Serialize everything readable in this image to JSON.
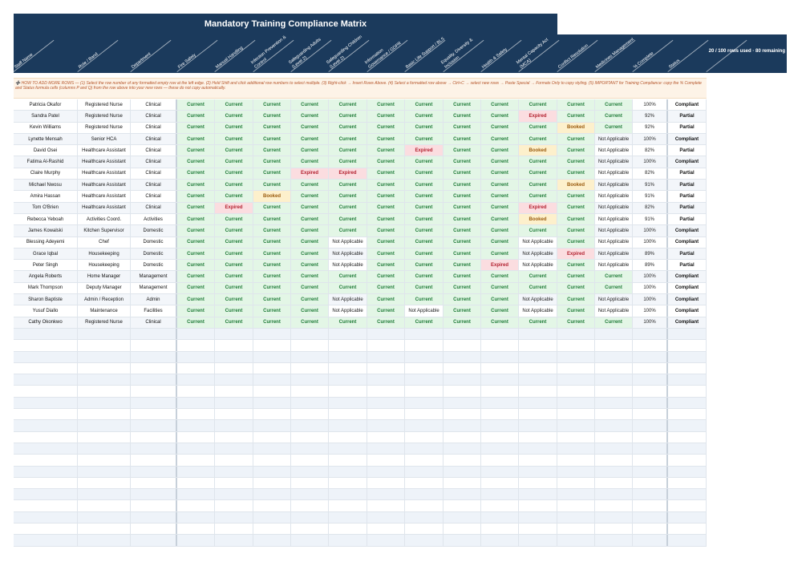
{
  "title": "Mandatory Training Compliance Matrix",
  "rows_used": "20 / 100 rows used  ·  80 remaining",
  "columns": [
    [
      "Staff Name"
    ],
    [
      "Role / Band"
    ],
    [
      "Department"
    ],
    [
      "Fire Safety"
    ],
    [
      "Manual Handling"
    ],
    [
      "Infection Prevention &",
      "Control"
    ],
    [
      "Safeguarding Adults",
      "(Level 2)"
    ],
    [
      "Safeguarding Children",
      "(Level 2)"
    ],
    [
      "Information",
      "Governance / GDPR"
    ],
    [
      "Basic Life Support / BLS"
    ],
    [
      "Equality, Diversity &",
      "Inclusion"
    ],
    [
      "Health & Safety"
    ],
    [
      "Mental Capacity Act",
      "(MCA)"
    ],
    [
      "Conflict Resolution"
    ],
    [
      "Medicines Management"
    ],
    [
      "% Complete"
    ],
    [
      "Status"
    ]
  ],
  "instructions": "➕ HOW TO ADD MORE ROWS  —  (1) Select the row number of any formatted empty row at the left edge.  (2) Hold Shift and click additional row numbers to select multiple.  (3) Right-click → Insert Rows Above.  (4) Select a formatted row above → Ctrl+C → select new rows → Paste Special → Formats Only to copy styling.  (5) IMPORTANT for Training Compliance: copy the % Complete and Status formula cells (columns P and Q) from the row above into your new rows — these do not copy automatically.",
  "rows": [
    {
      "name": "Patricia Okafor",
      "role": "Registered Nurse",
      "dept": "Clinical",
      "t": [
        "Current",
        "Current",
        "Current",
        "Current",
        "Current",
        "Current",
        "Current",
        "Current",
        "Current",
        "Current",
        "Current",
        "Current"
      ],
      "pct": "100%",
      "status": "Compliant"
    },
    {
      "name": "Sandra Patel",
      "role": "Registered Nurse",
      "dept": "Clinical",
      "t": [
        "Current",
        "Current",
        "Current",
        "Current",
        "Current",
        "Current",
        "Current",
        "Current",
        "Current",
        "Expired",
        "Current",
        "Current"
      ],
      "pct": "92%",
      "status": "Partial"
    },
    {
      "name": "Kevin Williams",
      "role": "Registered Nurse",
      "dept": "Clinical",
      "t": [
        "Current",
        "Current",
        "Current",
        "Current",
        "Current",
        "Current",
        "Current",
        "Current",
        "Current",
        "Current",
        "Booked",
        "Current"
      ],
      "pct": "92%",
      "status": "Partial"
    },
    {
      "name": "Lynette Mensah",
      "role": "Senior HCA",
      "dept": "Clinical",
      "t": [
        "Current",
        "Current",
        "Current",
        "Current",
        "Current",
        "Current",
        "Current",
        "Current",
        "Current",
        "Current",
        "Current",
        "Not Applicable"
      ],
      "pct": "100%",
      "status": "Compliant"
    },
    {
      "name": "David Osei",
      "role": "Healthcare Assistant",
      "dept": "Clinical",
      "t": [
        "Current",
        "Current",
        "Current",
        "Current",
        "Current",
        "Current",
        "Expired",
        "Current",
        "Current",
        "Booked",
        "Current",
        "Not Applicable"
      ],
      "pct": "82%",
      "status": "Partial"
    },
    {
      "name": "Fatima Al-Rashid",
      "role": "Healthcare Assistant",
      "dept": "Clinical",
      "t": [
        "Current",
        "Current",
        "Current",
        "Current",
        "Current",
        "Current",
        "Current",
        "Current",
        "Current",
        "Current",
        "Current",
        "Not Applicable"
      ],
      "pct": "100%",
      "status": "Compliant"
    },
    {
      "name": "Claire Murphy",
      "role": "Healthcare Assistant",
      "dept": "Clinical",
      "t": [
        "Current",
        "Current",
        "Current",
        "Expired",
        "Expired",
        "Current",
        "Current",
        "Current",
        "Current",
        "Current",
        "Current",
        "Not Applicable"
      ],
      "pct": "82%",
      "status": "Partial"
    },
    {
      "name": "Michael Nwosu",
      "role": "Healthcare Assistant",
      "dept": "Clinical",
      "t": [
        "Current",
        "Current",
        "Current",
        "Current",
        "Current",
        "Current",
        "Current",
        "Current",
        "Current",
        "Current",
        "Booked",
        "Not Applicable"
      ],
      "pct": "91%",
      "status": "Partial"
    },
    {
      "name": "Amira Hassan",
      "role": "Healthcare Assistant",
      "dept": "Clinical",
      "t": [
        "Current",
        "Current",
        "Booked",
        "Current",
        "Current",
        "Current",
        "Current",
        "Current",
        "Current",
        "Current",
        "Current",
        "Not Applicable"
      ],
      "pct": "91%",
      "status": "Partial"
    },
    {
      "name": "Tom O'Brien",
      "role": "Healthcare Assistant",
      "dept": "Clinical",
      "t": [
        "Current",
        "Expired",
        "Current",
        "Current",
        "Current",
        "Current",
        "Current",
        "Current",
        "Current",
        "Expired",
        "Current",
        "Not Applicable"
      ],
      "pct": "82%",
      "status": "Partial"
    },
    {
      "name": "Rebecca Yeboah",
      "role": "Activities Coord.",
      "dept": "Activities",
      "t": [
        "Current",
        "Current",
        "Current",
        "Current",
        "Current",
        "Current",
        "Current",
        "Current",
        "Current",
        "Booked",
        "Current",
        "Not Applicable"
      ],
      "pct": "91%",
      "status": "Partial"
    },
    {
      "name": "James Kowalski",
      "role": "Kitchen Supervisor",
      "dept": "Domestic",
      "t": [
        "Current",
        "Current",
        "Current",
        "Current",
        "Current",
        "Current",
        "Current",
        "Current",
        "Current",
        "Current",
        "Current",
        "Not Applicable"
      ],
      "pct": "100%",
      "status": "Compliant"
    },
    {
      "name": "Blessing Adeyemi",
      "role": "Chef",
      "dept": "Domestic",
      "t": [
        "Current",
        "Current",
        "Current",
        "Current",
        "Not Applicable",
        "Current",
        "Current",
        "Current",
        "Current",
        "Not Applicable",
        "Current",
        "Not Applicable"
      ],
      "pct": "100%",
      "status": "Compliant"
    },
    {
      "name": "Grace Iqbal",
      "role": "Housekeeping",
      "dept": "Domestic",
      "t": [
        "Current",
        "Current",
        "Current",
        "Current",
        "Not Applicable",
        "Current",
        "Current",
        "Current",
        "Current",
        "Not Applicable",
        "Expired",
        "Not Applicable"
      ],
      "pct": "89%",
      "status": "Partial"
    },
    {
      "name": "Peter Singh",
      "role": "Housekeeping",
      "dept": "Domestic",
      "t": [
        "Current",
        "Current",
        "Current",
        "Current",
        "Not Applicable",
        "Current",
        "Current",
        "Current",
        "Expired",
        "Not Applicable",
        "Current",
        "Not Applicable"
      ],
      "pct": "89%",
      "status": "Partial"
    },
    {
      "name": "Angela Roberts",
      "role": "Home Manager",
      "dept": "Management",
      "t": [
        "Current",
        "Current",
        "Current",
        "Current",
        "Current",
        "Current",
        "Current",
        "Current",
        "Current",
        "Current",
        "Current",
        "Current"
      ],
      "pct": "100%",
      "status": "Compliant"
    },
    {
      "name": "Mark Thompson",
      "role": "Deputy Manager",
      "dept": "Management",
      "t": [
        "Current",
        "Current",
        "Current",
        "Current",
        "Current",
        "Current",
        "Current",
        "Current",
        "Current",
        "Current",
        "Current",
        "Current"
      ],
      "pct": "100%",
      "status": "Compliant"
    },
    {
      "name": "Sharon Baptiste",
      "role": "Admin / Reception",
      "dept": "Admin",
      "t": [
        "Current",
        "Current",
        "Current",
        "Current",
        "Not Applicable",
        "Current",
        "Current",
        "Current",
        "Current",
        "Not Applicable",
        "Current",
        "Not Applicable"
      ],
      "pct": "100%",
      "status": "Compliant"
    },
    {
      "name": "Yusuf Diallo",
      "role": "Maintenance",
      "dept": "Facilities",
      "t": [
        "Current",
        "Current",
        "Current",
        "Current",
        "Not Applicable",
        "Current",
        "Not Applicable",
        "Current",
        "Current",
        "Not Applicable",
        "Current",
        "Not Applicable"
      ],
      "pct": "100%",
      "status": "Compliant"
    },
    {
      "name": "Cathy Okonkwo",
      "role": "Registered Nurse",
      "dept": "Clinical",
      "t": [
        "Current",
        "Current",
        "Current",
        "Current",
        "Current",
        "Current",
        "Current",
        "Current",
        "Current",
        "Current",
        "Current",
        "Current"
      ],
      "pct": "100%",
      "status": "Compliant"
    }
  ],
  "empty_rows": 19,
  "status_colors": {
    "current": "#1d7a36",
    "expired": "#b21f2d",
    "booked": "#9a5b0e",
    "header": "#1b3a5c"
  }
}
